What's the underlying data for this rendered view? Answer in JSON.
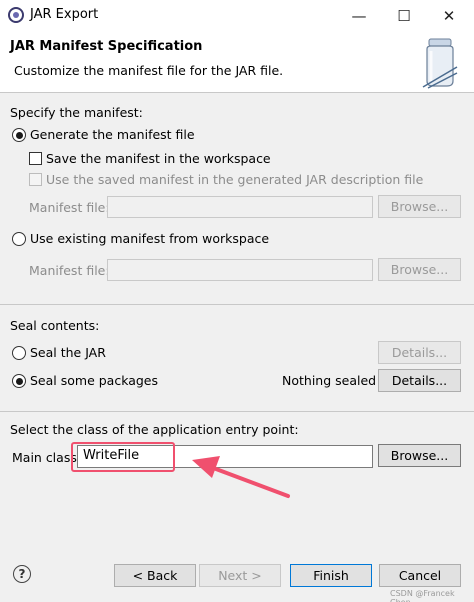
{
  "window": {
    "title": "JAR Export",
    "minimize": "—",
    "maximize": "☐",
    "close": "✕"
  },
  "banner": {
    "title": "JAR Manifest Specification",
    "description": "Customize the manifest file for the JAR file."
  },
  "manifest": {
    "heading": "Specify the manifest:",
    "generate_label": "Generate the manifest file",
    "generate_selected": true,
    "save_label": "Save the manifest in the workspace",
    "save_checked": false,
    "use_saved_label": "Use the saved manifest in the generated JAR description file",
    "use_saved_checked": false,
    "manifest_file_label": "Manifest file:",
    "browse_label": "Browse...",
    "use_existing_label": "Use existing manifest from workspace",
    "use_existing_selected": false,
    "manifest_file_label_2": "Manifest file:",
    "browse_label_2": "Browse..."
  },
  "seal": {
    "heading": "Seal contents:",
    "seal_jar_label": "Seal the JAR",
    "seal_jar_selected": false,
    "details_label": "Details...",
    "seal_packages_label": "Seal some packages",
    "seal_packages_selected": true,
    "status": "Nothing sealed",
    "details_label_2": "Details..."
  },
  "entry": {
    "heading": "Select the class of the application entry point:",
    "main_class_label": "Main class:",
    "main_class_value": "WriteFile",
    "browse_label": "Browse..."
  },
  "footer": {
    "help": "?",
    "back_label": "< Back",
    "next_label": "Next >",
    "finish_label": "Finish",
    "cancel_label": "Cancel"
  },
  "watermark": "CSDN @Francek Chen",
  "colors": {
    "annotation": "#f0506e",
    "focus_border": "#0078d7"
  }
}
